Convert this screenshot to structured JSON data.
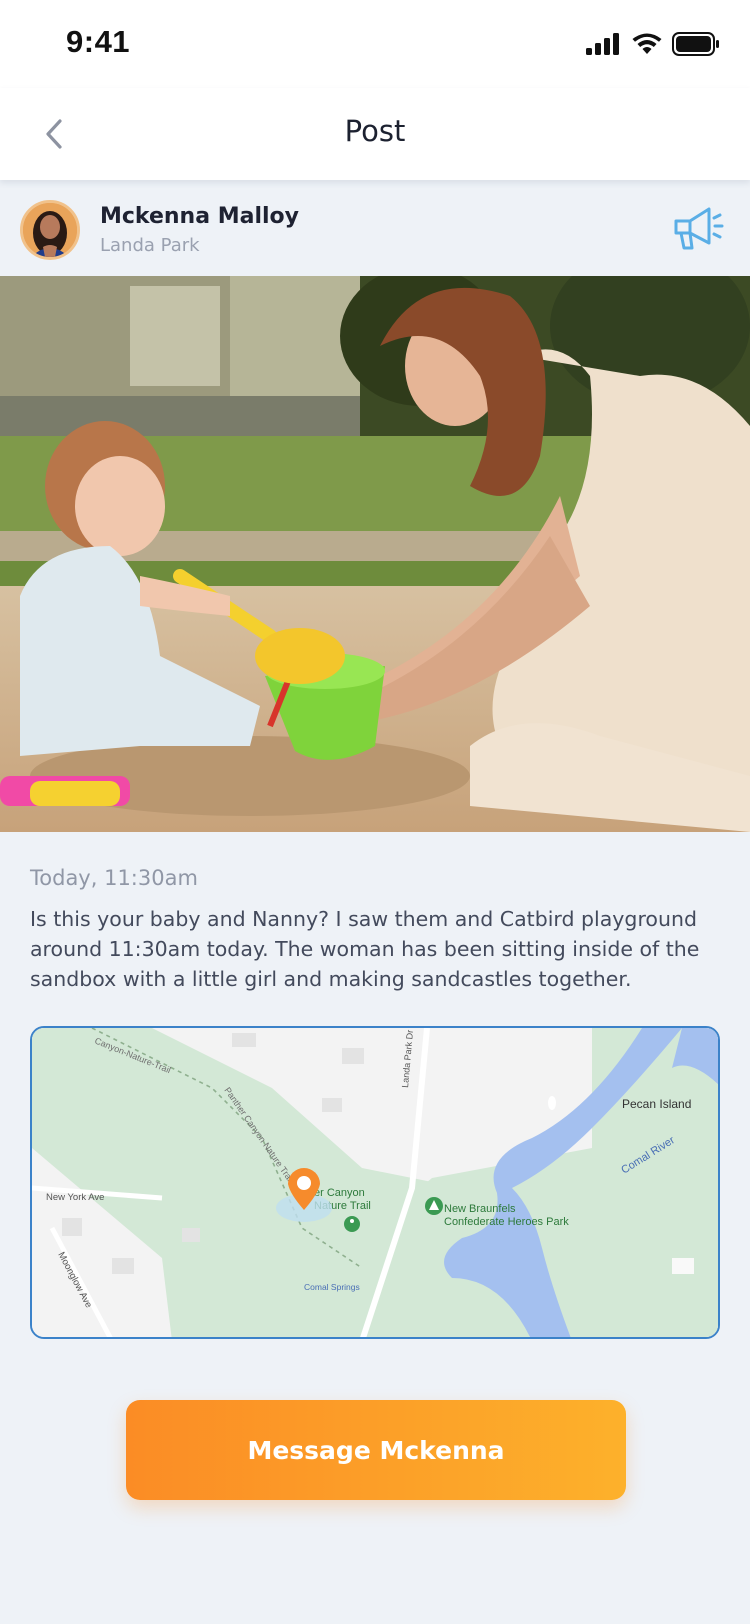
{
  "status_bar": {
    "time": "9:41"
  },
  "nav": {
    "title": "Post"
  },
  "post": {
    "author_name": "Mckenna Malloy",
    "location": "Landa Park",
    "timestamp": "Today, 11:30am",
    "body": "Is this your baby and Nanny? I saw them and Catbird playground around 11:30am today. The woman has been sitting inside of the sandbox with a little girl and making sandcastles together."
  },
  "map": {
    "labels": {
      "canyon_nature_trail": "Canyon-Nature-Trail",
      "panther_canyon_trail": "Panther Canyon Nature Trail",
      "landa_park_dr": "Landa Park Dr",
      "new_york_ave": "New York Ave",
      "moonglow_ave": "Moonglow Ave",
      "poi_trail_line1": "er Canyon",
      "poi_trail_line2": "Nature Trail",
      "park_line1": "New Braunfels",
      "park_line2": "Confederate Heroes Park",
      "comal_springs": "Comal Springs",
      "pecan_island": "Pecan Island",
      "comal_river": "Comal River"
    }
  },
  "actions": {
    "message_label": "Message Mckenna"
  },
  "colors": {
    "accent_orange": "#fb8c25",
    "accent_yellow": "#fdb12b",
    "map_border": "#3b82c9",
    "megaphone": "#5aaee6"
  }
}
